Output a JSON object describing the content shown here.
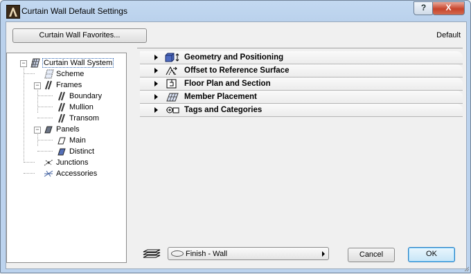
{
  "window": {
    "title": "Curtain Wall Default Settings",
    "help_label": "?",
    "close_label": "X"
  },
  "toolbar": {
    "favorites_label": "Curtain Wall Favorites...",
    "default_label": "Default"
  },
  "tree": {
    "root": "Curtain Wall System",
    "items": [
      {
        "label": "Scheme"
      },
      {
        "label": "Frames"
      },
      {
        "label": "Boundary"
      },
      {
        "label": "Mullion"
      },
      {
        "label": "Transom"
      },
      {
        "label": "Panels"
      },
      {
        "label": "Main"
      },
      {
        "label": "Distinct"
      },
      {
        "label": "Junctions"
      },
      {
        "label": "Accessories"
      }
    ]
  },
  "panels": [
    {
      "label": "Geometry and Positioning",
      "icon": "geometry-icon"
    },
    {
      "label": "Offset to Reference Surface",
      "icon": "offset-icon"
    },
    {
      "label": "Floor Plan and Section",
      "icon": "floorplan-icon"
    },
    {
      "label": "Member Placement",
      "icon": "member-placement-icon"
    },
    {
      "label": "Tags and Categories",
      "icon": "tags-icon"
    }
  ],
  "footer": {
    "finish_label": "Finish - Wall",
    "cancel_label": "Cancel",
    "ok_label": "OK"
  }
}
